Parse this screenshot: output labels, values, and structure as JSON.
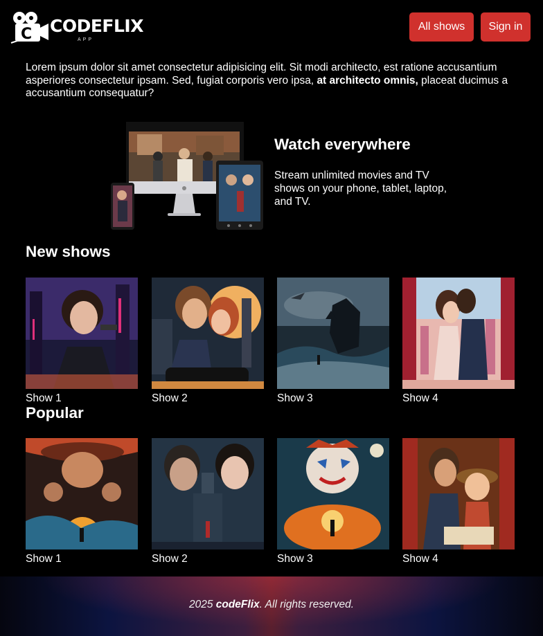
{
  "header": {
    "logo_text": "CODEFLIX",
    "logo_sub": "APP",
    "all_shows_label": "All shows",
    "sign_in_label": "Sign in",
    "accent_color": "#d0312d"
  },
  "intro": {
    "text": "Lorem ipsum dolor sit amet consectetur adipisicing elit. Sit modi architecto, est ratione accusantium asperiores consectetur ipsam. Sed, fugiat corporis vero ipsa, ",
    "bold": "at architecto omnis,",
    "tail": " placeat ducimus a accusantium consequatur?"
  },
  "watch": {
    "title": "Watch everywhere",
    "description": "Stream unlimited movies and TV shows on your phone, tablet, laptop, and TV."
  },
  "new_shows": {
    "title": "New shows",
    "items": [
      {
        "label": "Show 1",
        "icon": "poster-neon-agent"
      },
      {
        "label": "Show 2",
        "icon": "poster-romance-city"
      },
      {
        "label": "Show 3",
        "icon": "poster-kaiju"
      },
      {
        "label": "Show 4",
        "icon": "poster-couple-skyline"
      }
    ]
  },
  "popular": {
    "title": "Popular",
    "items": [
      {
        "label": "Show 1",
        "icon": "poster-adventure"
      },
      {
        "label": "Show 2",
        "icon": "poster-noir"
      },
      {
        "label": "Show 3",
        "icon": "poster-clown"
      },
      {
        "label": "Show 4",
        "icon": "poster-family"
      }
    ]
  },
  "footer": {
    "year": "2025 ",
    "brand": "codeFlix",
    "rights": ". All rights reserved."
  }
}
